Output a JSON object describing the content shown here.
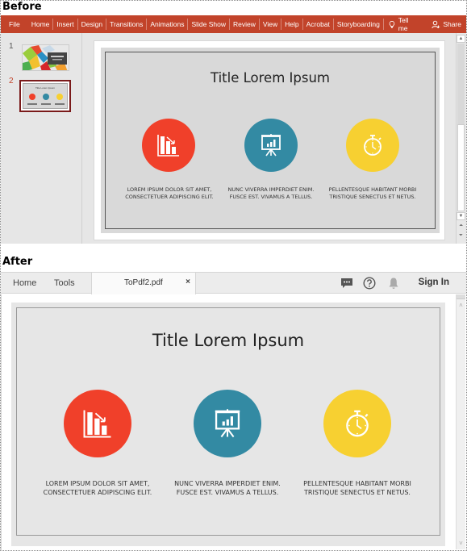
{
  "labels": {
    "before": "Before",
    "after": "After"
  },
  "powerpoint": {
    "ribbon_color": "#c2432a",
    "tabs": [
      "File",
      "Home",
      "Insert",
      "Design",
      "Transitions",
      "Animations",
      "Slide Show",
      "Review",
      "View",
      "Help",
      "Acrobat",
      "Storyboarding"
    ],
    "tell_me": "Tell me",
    "share": "Share",
    "thumbnails": [
      {
        "number": "1",
        "selected": false
      },
      {
        "number": "2",
        "selected": true
      }
    ],
    "thumb2_title": "Title Lorem Ipsum"
  },
  "slide": {
    "title": "Title Lorem Ipsum",
    "items": [
      {
        "icon": "bar-chart-down-icon",
        "color": "#f0402a",
        "line1": "LOREM IPSUM DOLOR SIT AMET,",
        "line2": "CONSECTETUER ADIPISCING ELIT."
      },
      {
        "icon": "presentation-board-icon",
        "color": "#338aa3",
        "line1": "NUNC VIVERRA IMPERDIET ENIM.",
        "line2": "FUSCE EST. VIVAMUS A TELLUS."
      },
      {
        "icon": "stopwatch-icon",
        "color": "#f7d031",
        "line1": "PELLENTESQUE HABITANT MORBI",
        "line2": "TRISTIQUE SENECTUS ET NETUS."
      }
    ]
  },
  "acrobat": {
    "nav": [
      "Home",
      "Tools"
    ],
    "tab_name": "ToPdf2.pdf",
    "close_symbol": "×",
    "sign_in": "Sign In"
  }
}
